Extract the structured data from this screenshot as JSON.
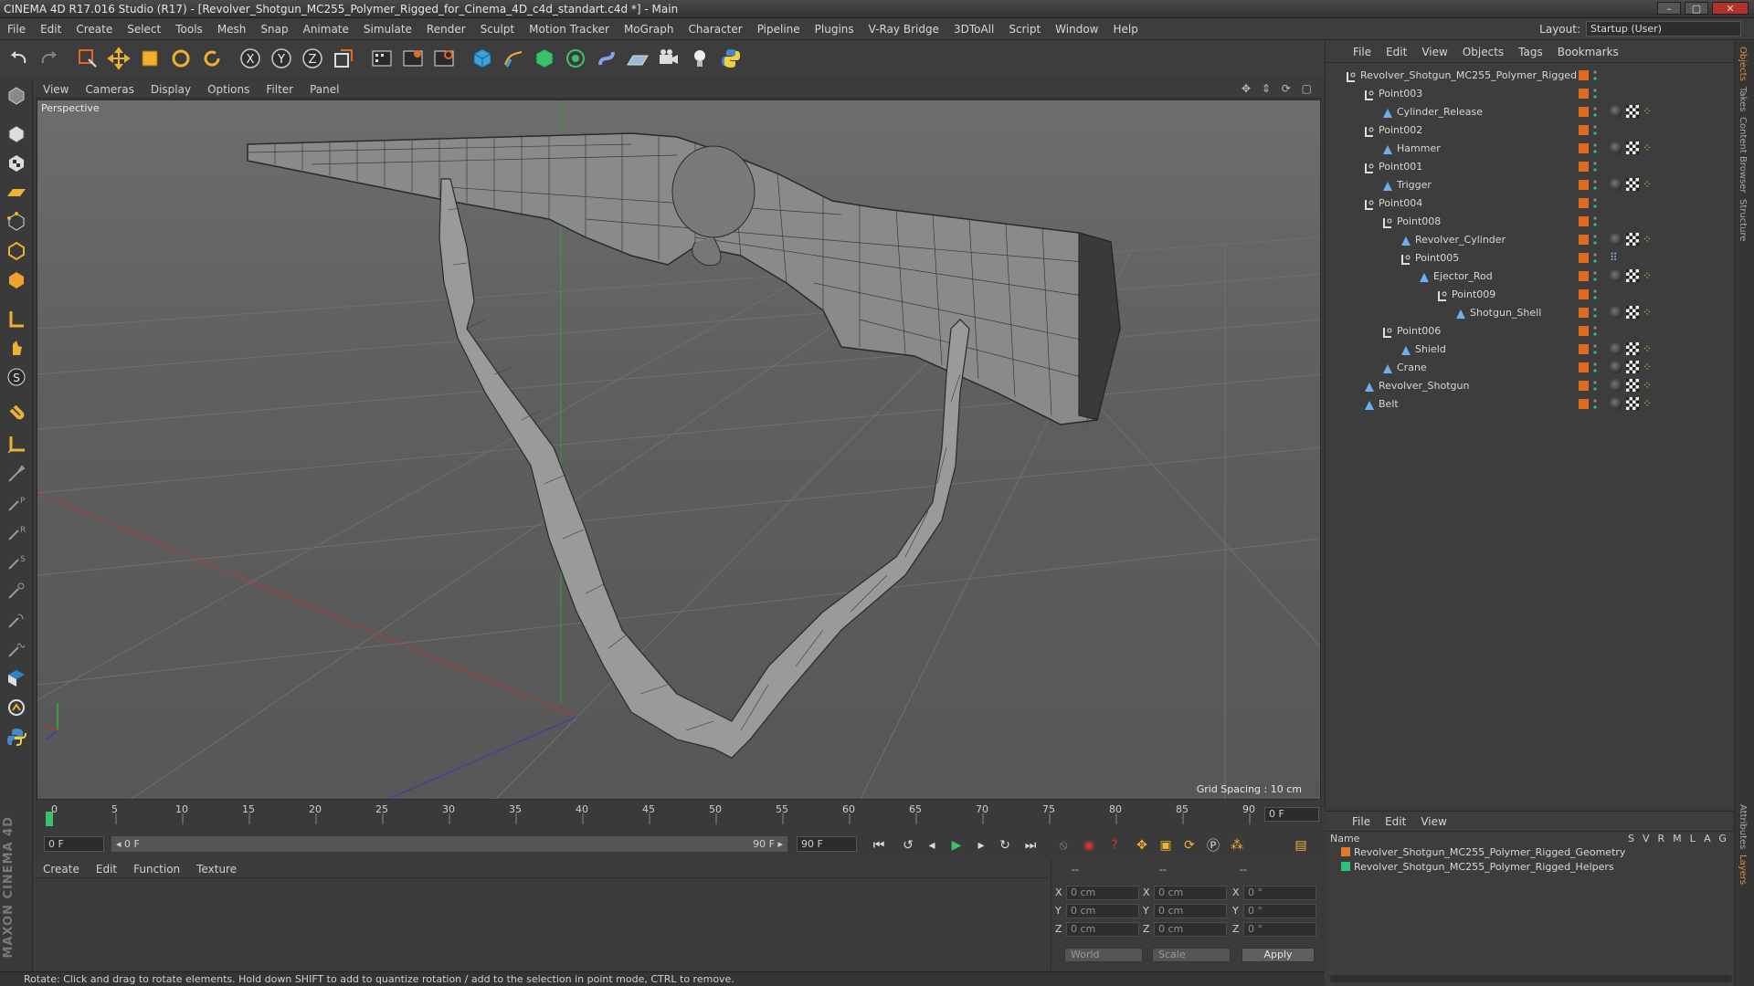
{
  "window": {
    "title": "CINEMA 4D R17.016 Studio (R17) - [Revolver_Shotgun_MC255_Polymer_Rigged_for_Cinema_4D_c4d_standart.c4d *] - Main",
    "buttons": [
      "–",
      "▢",
      "✕"
    ]
  },
  "menubar": {
    "items": [
      "File",
      "Edit",
      "Create",
      "Select",
      "Tools",
      "Mesh",
      "Snap",
      "Animate",
      "Simulate",
      "Render",
      "Sculpt",
      "Motion Tracker",
      "MoGraph",
      "Character",
      "Pipeline",
      "Plugins",
      "V-Ray Bridge",
      "3DToAll",
      "Script",
      "Window",
      "Help"
    ],
    "layout_label": "Layout:",
    "layout_value": "Startup (User)"
  },
  "viewport": {
    "menu": [
      "View",
      "Cameras",
      "Display",
      "Options",
      "Filter",
      "Panel"
    ],
    "nav_icons": "✥ ⇕ ⟳ ▢",
    "camera_label": "Perspective",
    "grid_spacing": "Grid Spacing : 10 cm"
  },
  "timeline": {
    "ticks": [
      "0",
      "5",
      "10",
      "15",
      "20",
      "25",
      "30",
      "35",
      "40",
      "45",
      "50",
      "55",
      "60",
      "65",
      "70",
      "75",
      "80",
      "85",
      "90"
    ],
    "current_frame": "0 F",
    "start_field": "0 F",
    "range_start": "◂ 0 F",
    "range_end": "90 F ▸",
    "end_field": "90 F"
  },
  "material_manager": {
    "menu": [
      "Create",
      "Edit",
      "Function",
      "Texture"
    ]
  },
  "coordinates": {
    "header": [
      "--",
      "--",
      "--"
    ],
    "rows": [
      {
        "axis": "X",
        "pos": "0 cm",
        "size_axis": "X",
        "size": "0 cm",
        "rot_axis": "X",
        "rot": "0 °"
      },
      {
        "axis": "Y",
        "pos": "0 cm",
        "size_axis": "Y",
        "size": "0 cm",
        "rot_axis": "Y",
        "rot": "0 °"
      },
      {
        "axis": "Z",
        "pos": "0 cm",
        "size_axis": "Z",
        "size": "0 cm",
        "rot_axis": "Z",
        "rot": "0 °"
      }
    ],
    "space": "World",
    "mode": "Scale",
    "apply": "Apply"
  },
  "status": "Rotate: Click and drag to rotate elements. Hold down SHIFT to add to quantize rotation / add to the selection in point mode, CTRL to remove.",
  "objects": {
    "menu": [
      "File",
      "Edit",
      "View",
      "Objects",
      "Tags",
      "Bookmarks"
    ],
    "tree": [
      {
        "name": "Revolver_Shotgun_MC255_Polymer_Rigged",
        "level": 0,
        "type": "null",
        "tags": 0
      },
      {
        "name": "Point003",
        "level": 1,
        "type": "null",
        "tags": 0
      },
      {
        "name": "Cylinder_Release",
        "level": 2,
        "type": "bone",
        "tags": 3
      },
      {
        "name": "Point002",
        "level": 1,
        "type": "null",
        "tags": 0
      },
      {
        "name": "Hammer",
        "level": 2,
        "type": "bone",
        "tags": 3
      },
      {
        "name": "Point001",
        "level": 1,
        "type": "null",
        "tags": 0
      },
      {
        "name": "Trigger",
        "level": 2,
        "type": "bone",
        "tags": 3
      },
      {
        "name": "Point004",
        "level": 1,
        "type": "null",
        "tags": 0
      },
      {
        "name": "Point008",
        "level": 2,
        "type": "null",
        "tags": 0
      },
      {
        "name": "Revolver_Cylinder",
        "level": 3,
        "type": "bone",
        "tags": 3
      },
      {
        "name": "Point005",
        "level": 3,
        "type": "null",
        "tags": 1
      },
      {
        "name": "Ejector_Rod",
        "level": 4,
        "type": "bone",
        "tags": 3
      },
      {
        "name": "Point009",
        "level": 5,
        "type": "null",
        "tags": 0
      },
      {
        "name": "Shotgun_Shell",
        "level": 6,
        "type": "bone",
        "tags": 3
      },
      {
        "name": "Point006",
        "level": 2,
        "type": "null",
        "tags": 0
      },
      {
        "name": "Shield",
        "level": 3,
        "type": "bone",
        "tags": 3
      },
      {
        "name": "Crane",
        "level": 2,
        "type": "bone",
        "tags": 3
      },
      {
        "name": "Revolver_Shotgun",
        "level": 1,
        "type": "bone",
        "tags": 3
      },
      {
        "name": "Belt",
        "level": 1,
        "type": "bone",
        "tags": 3
      }
    ]
  },
  "layers": {
    "menu": [
      "File",
      "Edit",
      "View"
    ],
    "header_name": "Name",
    "header_cols": [
      "S",
      "V",
      "R",
      "M",
      "L",
      "A",
      "G"
    ],
    "rows": [
      {
        "name": "Revolver_Shotgun_MC255_Polymer_Rigged_Geometry",
        "color": "#e07a2a"
      },
      {
        "name": "Revolver_Shotgun_MC255_Polymer_Rigged_Helpers",
        "color": "#2ec07a"
      }
    ]
  },
  "sidebar_tabs": [
    "Objects",
    "Takes",
    "Content Browser",
    "Structure"
  ],
  "sidebar_tabs_bottom": [
    "Attributes",
    "Layers"
  ],
  "colors": {
    "accent": "#e06a1f",
    "panel": "#3d3d3d",
    "viewport": "#636363"
  }
}
